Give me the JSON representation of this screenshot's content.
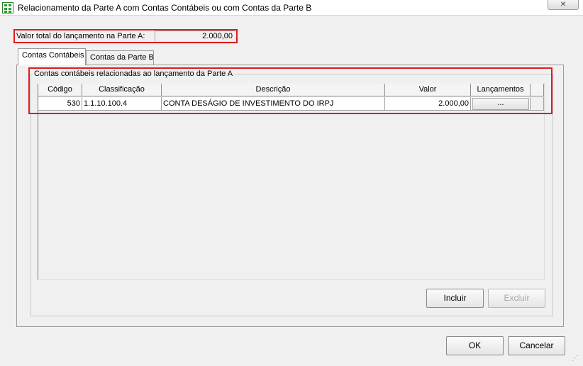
{
  "window": {
    "title": "Relacionamento da Parte A com Contas Contábeis ou com Contas da Parte B",
    "close_glyph": "✕"
  },
  "total": {
    "label": "Valor total do lançamento na Parte A:",
    "value": "2.000,00"
  },
  "tabs": [
    {
      "label": "Contas Contábeis",
      "active": true
    },
    {
      "label": "Contas da Parte B",
      "active": false
    }
  ],
  "group": {
    "title": "Contas contábeis relacionadas ao lançamento da Parte A"
  },
  "table": {
    "columns": [
      "Código",
      "Classificação",
      "Descrição",
      "Valor",
      "Lançamentos"
    ],
    "rows": [
      {
        "codigo": "530",
        "classificacao": "1.1.10.100.4",
        "descricao": "CONTA DESÁGIO DE INVESTIMENTO DO IRPJ",
        "valor": "2.000,00",
        "lancamentos": "..."
      }
    ]
  },
  "buttons": {
    "incluir": "Incluir",
    "excluir": "Excluir",
    "ok": "OK",
    "cancelar": "Cancelar"
  },
  "colors": {
    "highlight": "#e01b1b"
  },
  "icons": {
    "app": "spreadsheet-icon",
    "close": "close-icon"
  }
}
